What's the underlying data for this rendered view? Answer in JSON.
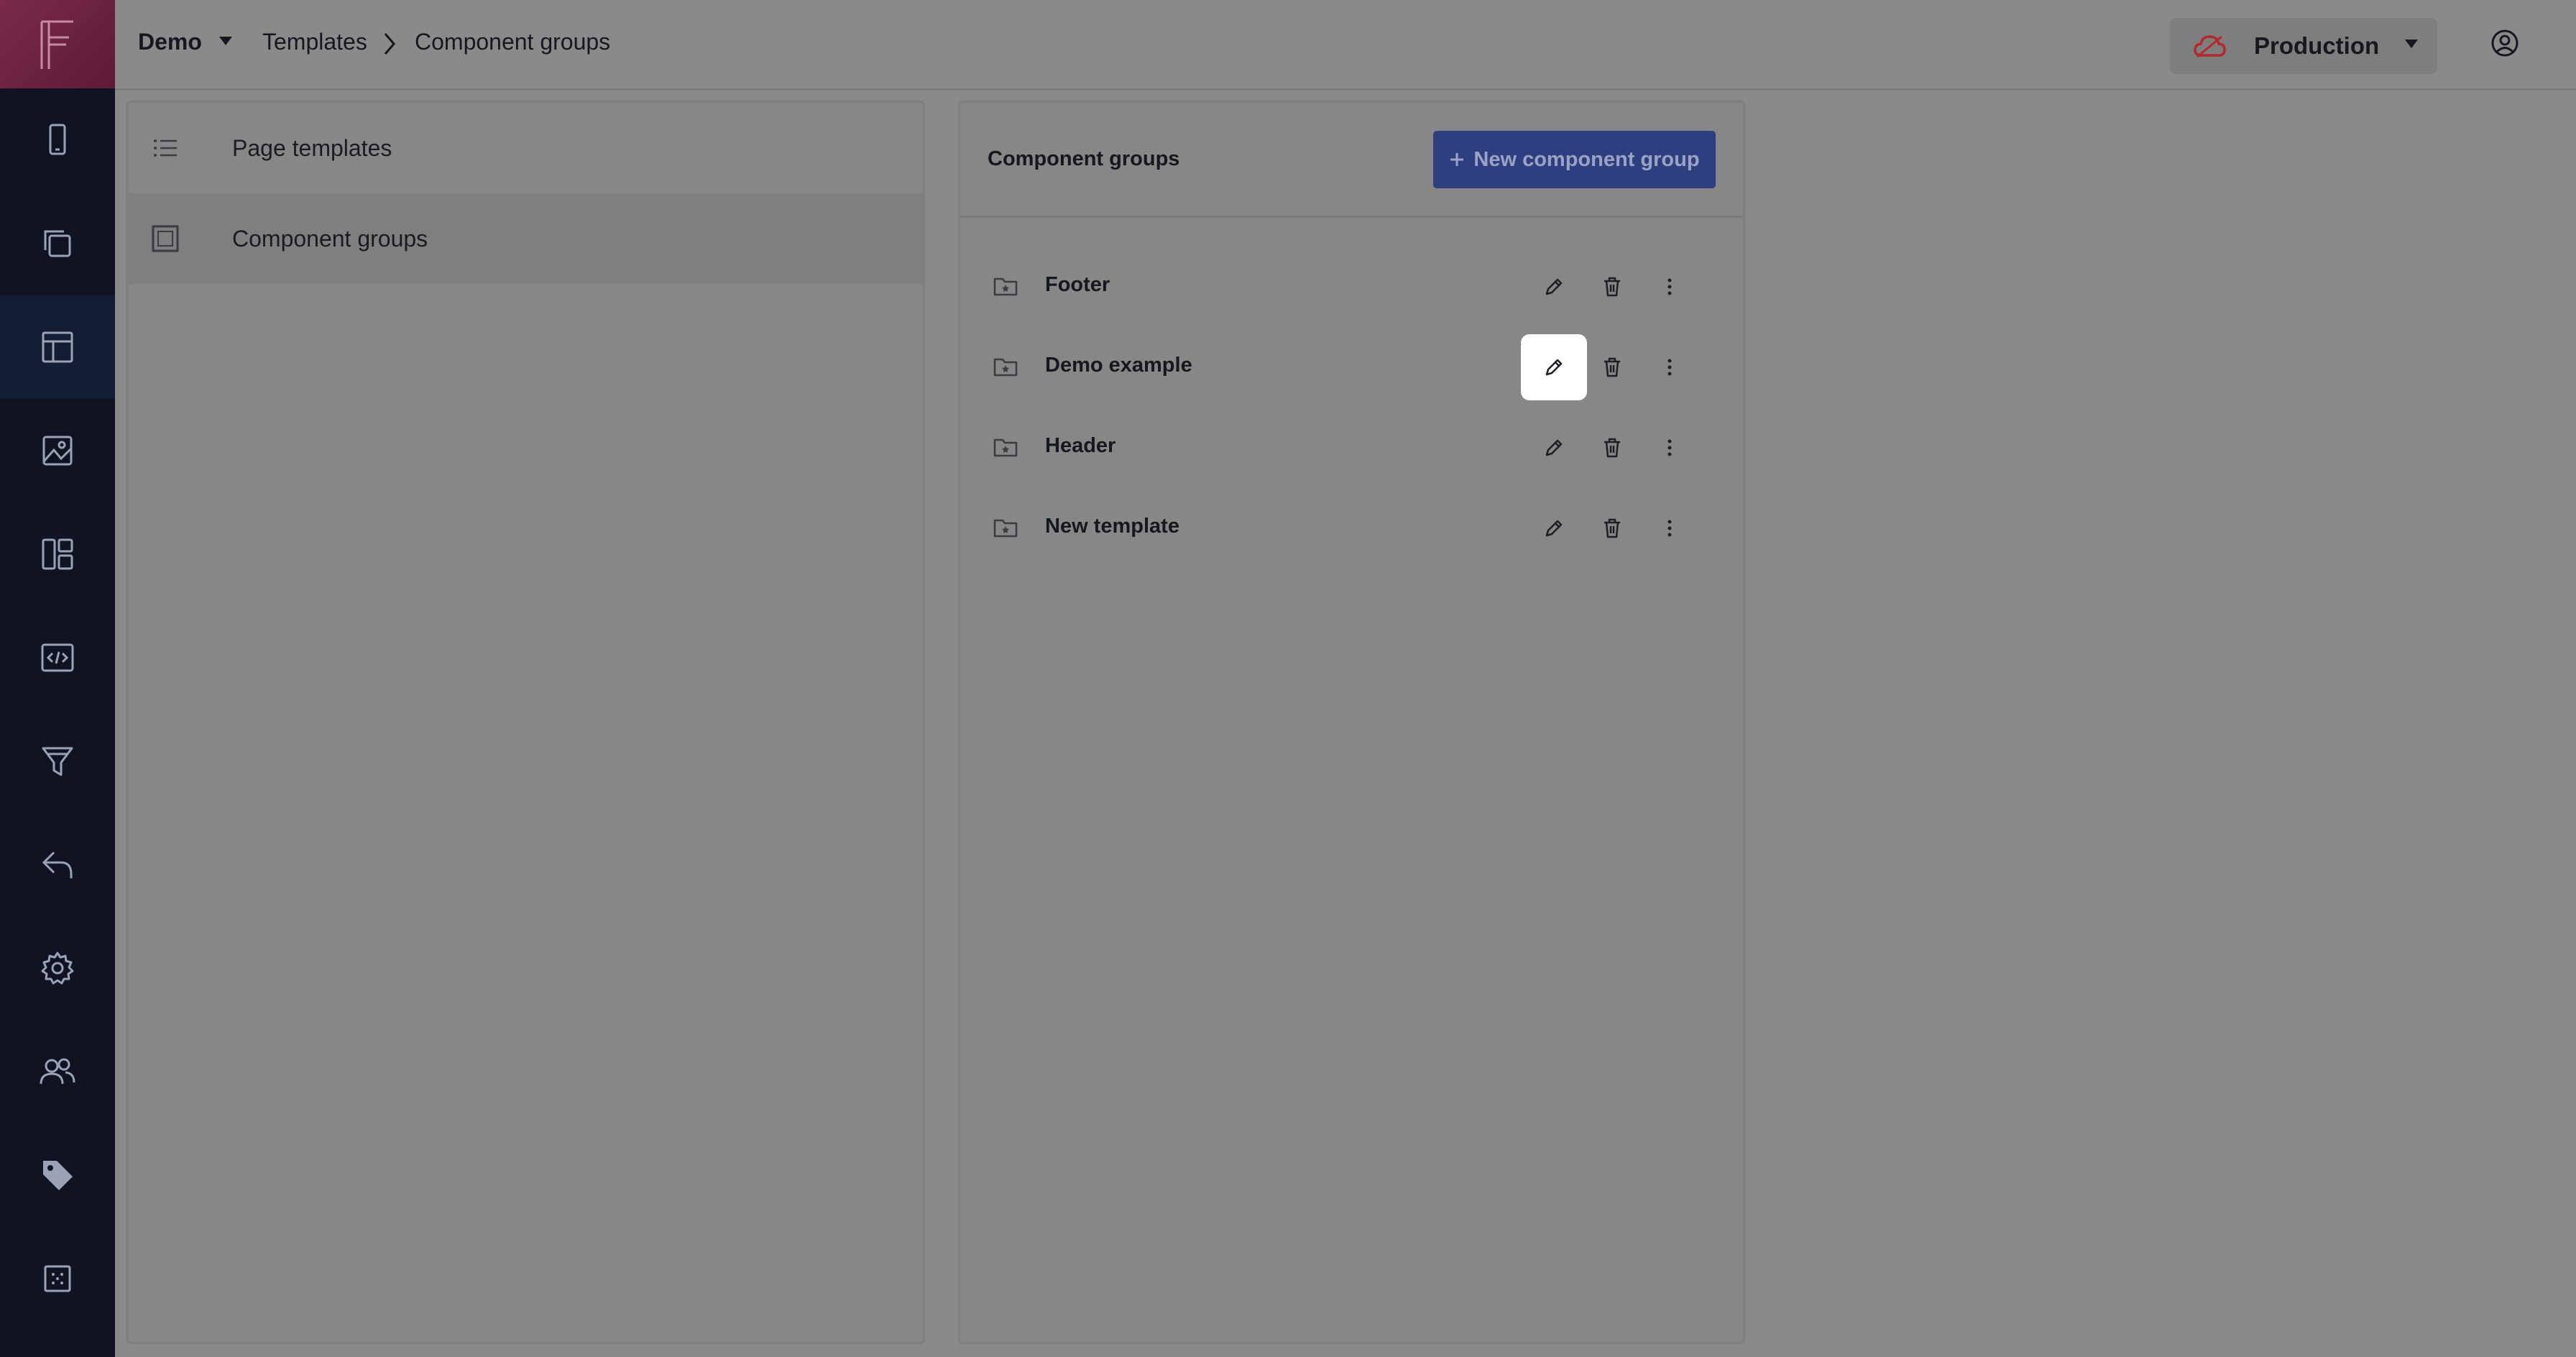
{
  "app": {
    "logo": "F"
  },
  "rail": [
    {
      "icon": "mobile-icon"
    },
    {
      "icon": "pages-icon"
    },
    {
      "icon": "templates-icon",
      "active": true
    },
    {
      "icon": "image-icon"
    },
    {
      "icon": "layout-icon"
    },
    {
      "icon": "code-icon"
    },
    {
      "icon": "funnel-icon"
    },
    {
      "icon": "reply-icon"
    },
    {
      "icon": "gear-icon"
    },
    {
      "icon": "users-icon"
    },
    {
      "icon": "tag-icon"
    },
    {
      "icon": "grid-icon"
    }
  ],
  "header": {
    "project": "Demo",
    "breadcrumb": {
      "parent": "Templates",
      "current": "Component groups"
    },
    "environment": "Production"
  },
  "subnav": {
    "items": [
      {
        "label": "Page templates",
        "icon": "list-icon"
      },
      {
        "label": "Component groups",
        "icon": "square-icon",
        "active": true
      }
    ]
  },
  "groups_panel": {
    "title": "Component groups",
    "new_button": "New component group",
    "items": [
      {
        "name": "Footer"
      },
      {
        "name": "Demo example",
        "edit_highlight": true
      },
      {
        "name": "Header"
      },
      {
        "name": "New template"
      }
    ]
  },
  "colors": {
    "accent": "#2e3f7f",
    "rail": "#0f1322",
    "cloud": "#b3282d"
  }
}
